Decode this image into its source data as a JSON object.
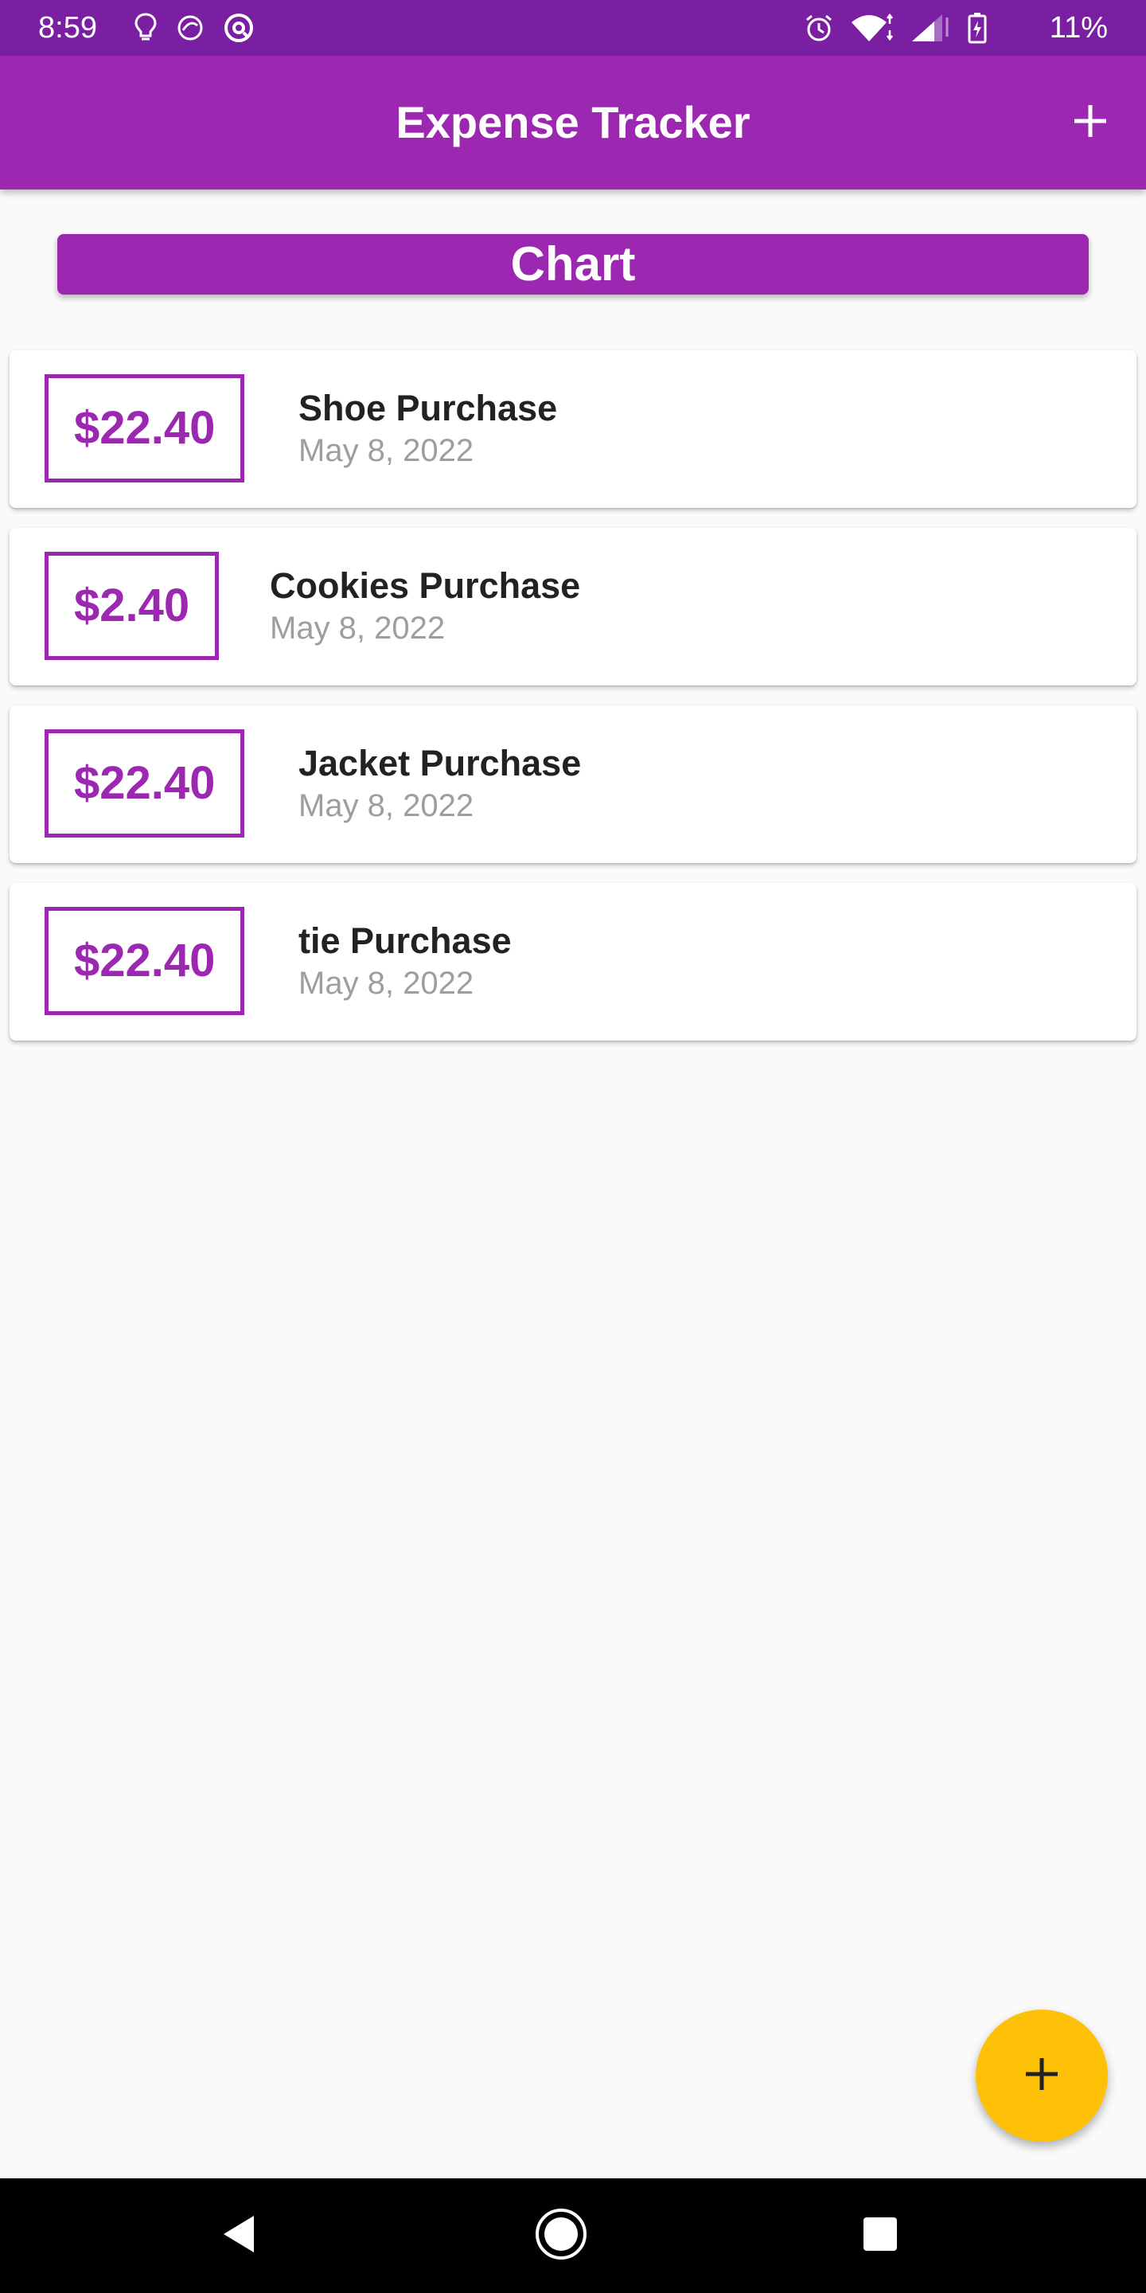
{
  "status_bar": {
    "time": "8:59",
    "battery_text": "11%",
    "left_icons": [
      "lightbulb-icon",
      "edge-lighting-icon",
      "at-sign-icon"
    ],
    "right_icons": [
      "alarm-icon",
      "wifi-icon",
      "signal-icon",
      "battery-charging-icon"
    ]
  },
  "app_bar": {
    "title": "Expense Tracker",
    "action_icon": "plus-icon"
  },
  "chart": {
    "label": "Chart"
  },
  "transactions": [
    {
      "amount": "$22.40",
      "title": "Shoe Purchase",
      "date": "May 8, 2022"
    },
    {
      "amount": "$2.40",
      "title": "Cookies Purchase",
      "date": "May 8, 2022"
    },
    {
      "amount": "$22.40",
      "title": "Jacket Purchase",
      "date": "May 8, 2022"
    },
    {
      "amount": "$22.40",
      "title": "tie Purchase",
      "date": "May 8, 2022"
    }
  ],
  "fab": {
    "icon": "plus-icon"
  },
  "colors": {
    "primary": "#9c27b0",
    "primary_dark": "#7b1fa2",
    "accent": "#ffc107",
    "background": "#fafafa"
  },
  "nav_bar": {
    "buttons": [
      "back-icon",
      "home-icon",
      "recents-icon"
    ]
  }
}
